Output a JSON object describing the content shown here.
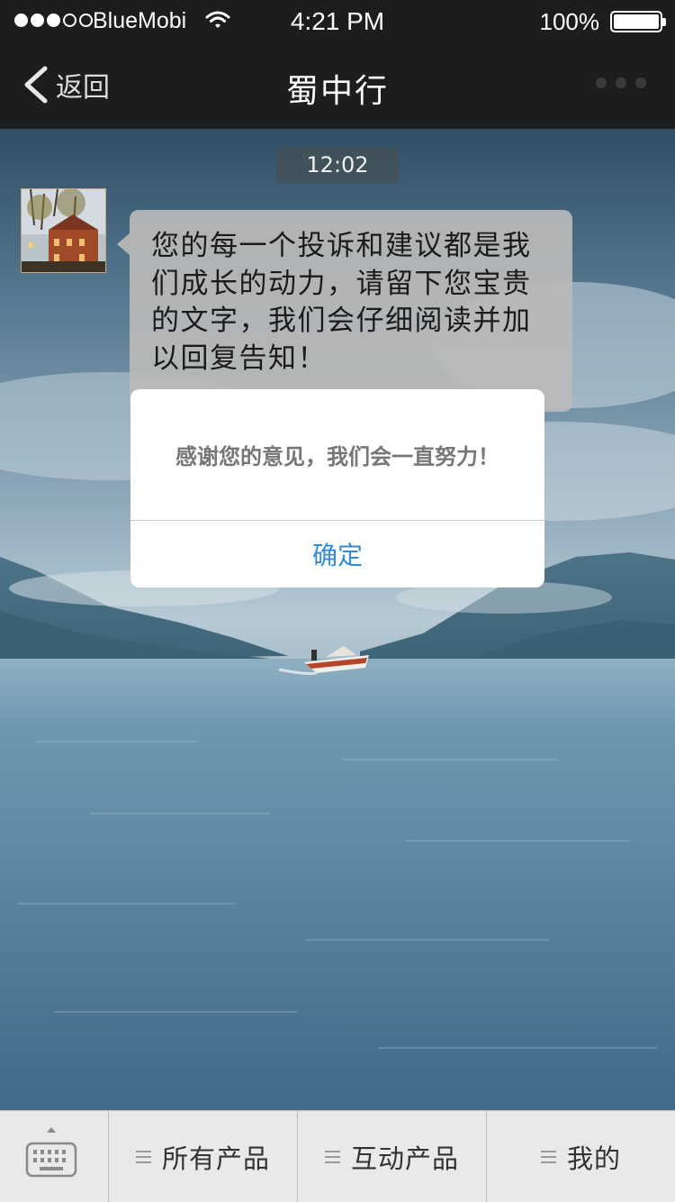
{
  "status_bar": {
    "carrier": "BlueMobi",
    "time": "4:21 PM",
    "battery": "100%",
    "battery_level": 1.0,
    "signal_strength": 3,
    "signal_max": 5
  },
  "nav": {
    "back_label": "返回",
    "title": "蜀中行",
    "back_icon": "chevron-left-icon",
    "more_icon": "more-dots-icon"
  },
  "chat": {
    "timestamp": "12:02",
    "message": "您的每一个投诉和建议都是我们成长的动力，请留下您宝贵的文字，我们会仔细阅读并加以回复告知！"
  },
  "alert": {
    "message": "感谢您的意见，我们会一直努力！",
    "confirm_label": "确定"
  },
  "bottom_menu": {
    "keyboard_icon": "keyboard-icon",
    "items": [
      {
        "label": "所有产品",
        "icon": "menu-lines-icon"
      },
      {
        "label": "互动产品",
        "icon": "menu-lines-icon"
      },
      {
        "label": "我的",
        "icon": "menu-lines-icon"
      }
    ]
  },
  "colors": {
    "bar_bg": "#1d1d1f",
    "link_blue": "#2f8bdb",
    "menu_bg": "#e9e9ea"
  }
}
